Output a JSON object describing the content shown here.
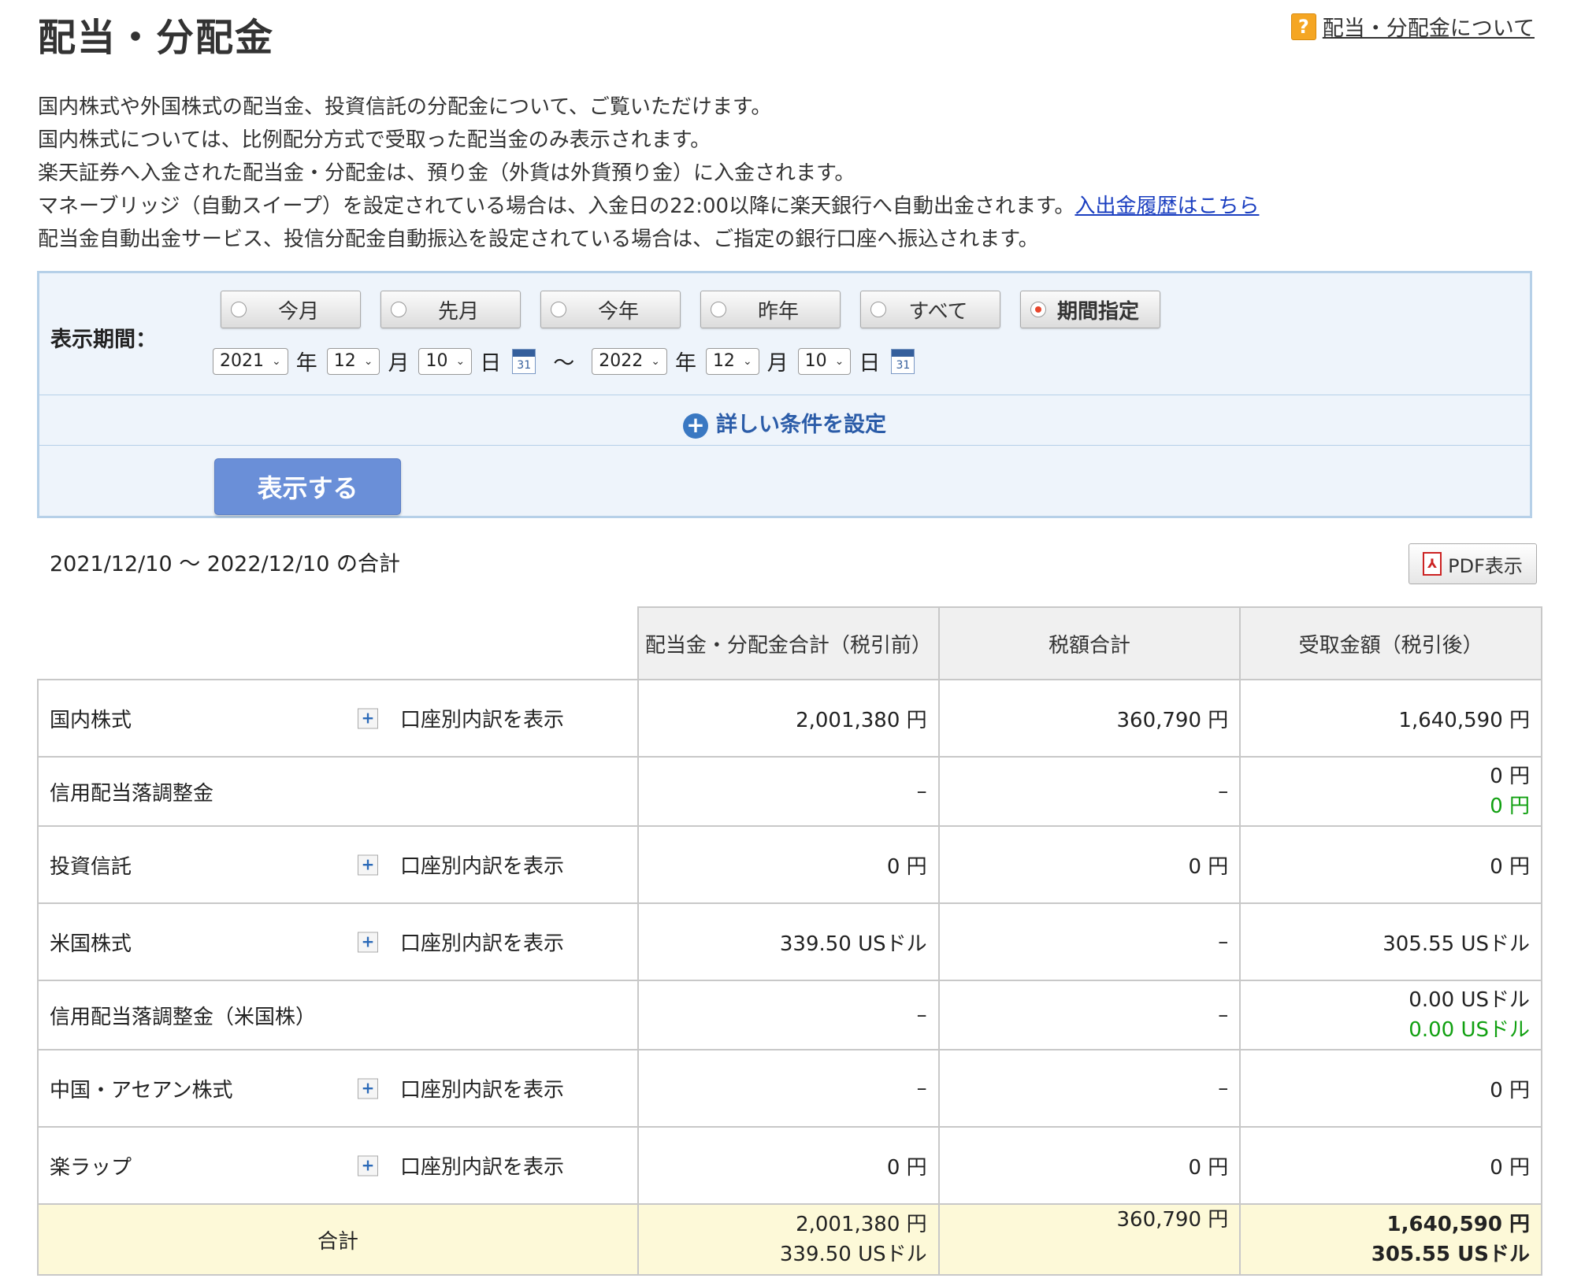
{
  "page": {
    "title": "配当・分配金",
    "help_link": "配当・分配金について"
  },
  "intro": {
    "line1": "国内株式や外国株式の配当金、投資信託の分配金について、ご覧いただけます。",
    "line2": "国内株式については、比例配分方式で受取った配当金のみ表示されます。",
    "line3": "楽天証券へ入金された配当金・分配金は、預り金（外貨は外貨預り金）に入金されます。",
    "line4": "マネーブリッジ（自動スイープ）を設定されている場合は、入金日の22:00以降に楽天銀行へ自動出金されます。",
    "line4_link": "入出金履歴はこちら",
    "line5": "配当金自動出金サービス、投信分配金自動振込を設定されている場合は、ご指定の銀行口座へ振込されます。"
  },
  "search": {
    "period_label": "表示期間：",
    "radios": [
      {
        "label": "今月",
        "selected": false
      },
      {
        "label": "先月",
        "selected": false
      },
      {
        "label": "今年",
        "selected": false
      },
      {
        "label": "昨年",
        "selected": false
      },
      {
        "label": "すべて",
        "selected": false
      },
      {
        "label": "期間指定",
        "selected": true
      }
    ],
    "from": {
      "year": "2021",
      "month": "12",
      "day": "10"
    },
    "to": {
      "year": "2022",
      "month": "12",
      "day": "10"
    },
    "unit_year": "年",
    "unit_month": "月",
    "unit_day": "日",
    "tilde": "～",
    "calendar_text": "31",
    "detail_link": "詳しい条件を設定",
    "show_button": "表示する"
  },
  "range_total": "2021/12/10 ～ 2022/12/10 の合計",
  "pdf_button": "PDF表示",
  "table": {
    "headers": [
      "",
      "配当金・分配金合計（税引前）",
      "税額合計",
      "受取金額（税引後）"
    ],
    "breakdown_label": "口座別内訳を表示",
    "rows": [
      {
        "name": "国内株式",
        "pre_tax": "2,001,380 円",
        "tax": "360,790 円",
        "received": "1,640,590 円",
        "received2": ""
      },
      {
        "name": "信用配当落調整金",
        "pre_tax": "–",
        "tax": "–",
        "received": "0 円",
        "received2": "0 円"
      },
      {
        "name": "投資信託",
        "pre_tax": "0 円",
        "tax": "0 円",
        "received": "0 円",
        "received2": ""
      },
      {
        "name": "米国株式",
        "pre_tax": "339.50 USドル",
        "tax": "–",
        "received": "305.55 USドル",
        "received2": ""
      },
      {
        "name": "信用配当落調整金（米国株）",
        "pre_tax": "–",
        "tax": "–",
        "received": "0.00 USドル",
        "received2": "0.00 USドル"
      },
      {
        "name": "中国・アセアン株式",
        "pre_tax": "–",
        "tax": "–",
        "received": "0 円",
        "received2": ""
      },
      {
        "name": "楽ラップ",
        "pre_tax": "0 円",
        "tax": "0 円",
        "received": "0 円",
        "received2": ""
      }
    ],
    "total": {
      "label": "合計",
      "pre_tax_jpy": "2,001,380 円",
      "pre_tax_usd": "339.50 USドル",
      "tax_jpy": "360,790 円",
      "received_jpy": "1,640,590 円",
      "received_usd": "305.55 USドル"
    }
  },
  "colors": {
    "accent_blue": "#6a8fd8",
    "positive_green": "#11a011",
    "total_row_bg": "#fdf9d8"
  }
}
